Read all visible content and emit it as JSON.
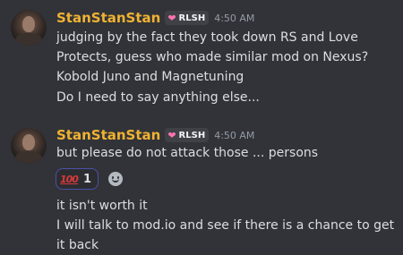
{
  "messages": [
    {
      "username": "StanStanStan",
      "tag": "RLSH",
      "tag_icon": "heart-icon",
      "timestamp": "4:50 AM",
      "lines": [
        "judging by the fact they took down RS and Love Protects, guess who made similar mod on Nexus?",
        "Kobold Juno and Magnetuning",
        "Do I need to say anything else..."
      ]
    },
    {
      "username": "StanStanStan",
      "tag": "RLSH",
      "tag_icon": "heart-icon",
      "timestamp": "4:50 AM",
      "lines": [
        "but please do not attack those ... persons"
      ],
      "reaction": {
        "emoji": "100",
        "emoji_name": "hundred-points-emoji",
        "count": "1"
      },
      "follow_lines": [
        "it isn't worth it",
        "I will talk to mod.io and see if there is a chance to get it back"
      ]
    }
  ],
  "colors": {
    "background": "#313338",
    "username": "#f0b232",
    "text": "#dbdee1",
    "timestamp": "#949ba4",
    "reaction_border": "#4e50a8"
  }
}
